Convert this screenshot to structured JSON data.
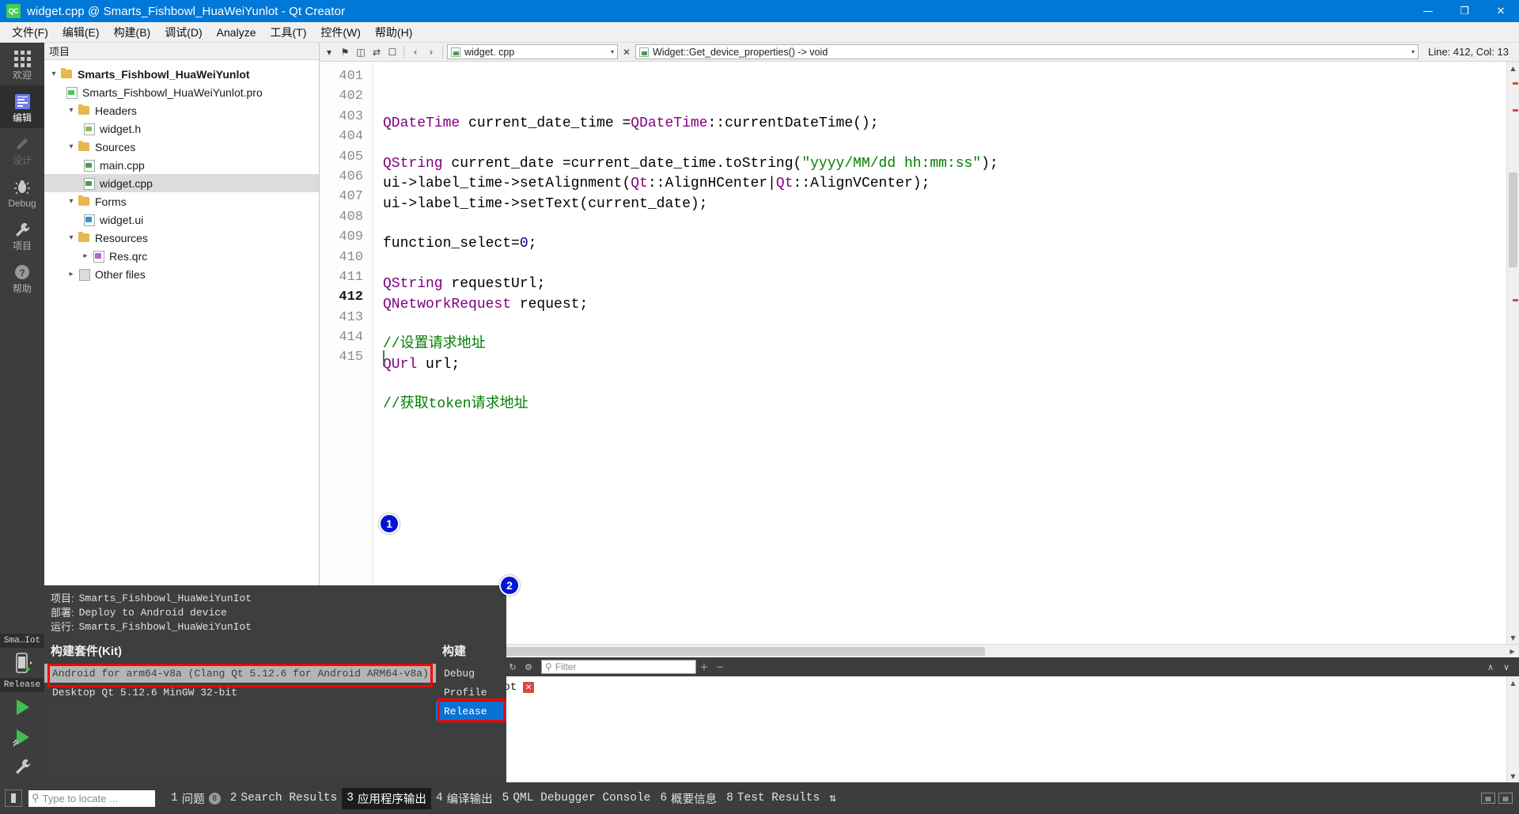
{
  "window": {
    "title": "widget.cpp @ Smarts_Fishbowl_HuaWeiYunlot - Qt Creator",
    "app_icon_text": "QC",
    "minimize": "—",
    "maximize": "❐",
    "close": "✕",
    "titlebar_color": "#0078d7"
  },
  "menubar": {
    "items": [
      {
        "label": "文件(F)"
      },
      {
        "label": "编辑(E)"
      },
      {
        "label": "构建(B)"
      },
      {
        "label": "调试(D)"
      },
      {
        "label": "Analyze"
      },
      {
        "label": "工具(T)"
      },
      {
        "label": "控件(W)"
      },
      {
        "label": "帮助(H)"
      }
    ]
  },
  "modebar": {
    "items": [
      {
        "label": "欢迎",
        "icon": "grid-icon",
        "state": "normal"
      },
      {
        "label": "编辑",
        "icon": "edit-icon",
        "state": "active"
      },
      {
        "label": "设计",
        "icon": "pencil-icon",
        "state": "disabled"
      },
      {
        "label": "Debug",
        "icon": "bug-icon",
        "state": "normal"
      },
      {
        "label": "项目",
        "icon": "wrench-icon",
        "state": "normal"
      },
      {
        "label": "帮助",
        "icon": "help-icon",
        "state": "normal"
      }
    ],
    "kit_summary": "Sma…Iot",
    "run_label": "Release"
  },
  "project_panel": {
    "header": "项目",
    "tree": [
      {
        "label": "Smarts_Fishbowl_HuaWeiYunlot",
        "indent": 0,
        "arrow": "down",
        "icon": "folder",
        "bold": true,
        "selected": false
      },
      {
        "label": "Smarts_Fishbowl_HuaWeiYunlot.pro",
        "indent": 1,
        "arrow": "none",
        "icon": "qtproj",
        "bold": false,
        "selected": false
      },
      {
        "label": "Headers",
        "indent": 1,
        "arrow": "down",
        "icon": "folder",
        "bold": false,
        "selected": false
      },
      {
        "label": "widget.h",
        "indent": 2,
        "arrow": "none",
        "icon": "hfile",
        "bold": false,
        "selected": false
      },
      {
        "label": "Sources",
        "indent": 1,
        "arrow": "down",
        "icon": "folder",
        "bold": false,
        "selected": false
      },
      {
        "label": "main.cpp",
        "indent": 2,
        "arrow": "none",
        "icon": "cfile",
        "bold": false,
        "selected": false
      },
      {
        "label": "widget.cpp",
        "indent": 2,
        "arrow": "none",
        "icon": "cfile",
        "bold": false,
        "selected": true
      },
      {
        "label": "Forms",
        "indent": 1,
        "arrow": "down",
        "icon": "folder",
        "bold": false,
        "selected": false
      },
      {
        "label": "widget.ui",
        "indent": 2,
        "arrow": "none",
        "icon": "ui",
        "bold": false,
        "selected": false
      },
      {
        "label": "Resources",
        "indent": 1,
        "arrow": "down",
        "icon": "folder",
        "bold": false,
        "selected": false
      },
      {
        "label": "Res.qrc",
        "indent": 2,
        "arrow": "right",
        "icon": "qrc",
        "bold": false,
        "selected": false
      },
      {
        "label": "Other files",
        "indent": 1,
        "arrow": "right",
        "icon": "other",
        "bold": false,
        "selected": false
      }
    ]
  },
  "editor_toolbar": {
    "file_combo": "widget. cpp",
    "symbol_combo": "Widget::Get_device_properties() -> void",
    "line_col": "Line: 412, Col: 13",
    "close_x": "✕",
    "split_caret": "▾"
  },
  "editor": {
    "first_line": 401,
    "current_line": 412,
    "caret_line": 415,
    "lines": [
      {
        "n": 401,
        "tokens": [
          {
            "t": "QDateTime",
            "c": "type"
          },
          {
            "t": " current_date_time =",
            "c": "plain"
          },
          {
            "t": "QDateTime",
            "c": "type"
          },
          {
            "t": "::",
            "c": "plain"
          },
          {
            "t": "currentDateTime",
            "c": "fn"
          },
          {
            "t": "();",
            "c": "plain"
          }
        ]
      },
      {
        "n": 402,
        "tokens": []
      },
      {
        "n": 403,
        "tokens": [
          {
            "t": "QString",
            "c": "type"
          },
          {
            "t": " current_date =current_date_time.",
            "c": "plain"
          },
          {
            "t": "toString",
            "c": "fn"
          },
          {
            "t": "(",
            "c": "plain"
          },
          {
            "t": "\"yyyy/MM/dd hh:mm:ss\"",
            "c": "str"
          },
          {
            "t": ");",
            "c": "plain"
          }
        ]
      },
      {
        "n": 404,
        "tokens": [
          {
            "t": "ui->label_time->",
            "c": "plain"
          },
          {
            "t": "setAlignment",
            "c": "fn"
          },
          {
            "t": "(",
            "c": "plain"
          },
          {
            "t": "Qt",
            "c": "type"
          },
          {
            "t": "::",
            "c": "plain"
          },
          {
            "t": "AlignHCenter",
            "c": "fn"
          },
          {
            "t": "|",
            "c": "plain"
          },
          {
            "t": "Qt",
            "c": "type"
          },
          {
            "t": "::",
            "c": "plain"
          },
          {
            "t": "AlignVCenter",
            "c": "fn"
          },
          {
            "t": ");",
            "c": "plain"
          }
        ]
      },
      {
        "n": 405,
        "tokens": [
          {
            "t": "ui->label_time->",
            "c": "plain"
          },
          {
            "t": "setText",
            "c": "fn"
          },
          {
            "t": "(current_date);",
            "c": "plain"
          }
        ]
      },
      {
        "n": 406,
        "tokens": []
      },
      {
        "n": 407,
        "tokens": [
          {
            "t": "function_select=",
            "c": "plain"
          },
          {
            "t": "0",
            "c": "num"
          },
          {
            "t": ";",
            "c": "plain"
          }
        ]
      },
      {
        "n": 408,
        "tokens": []
      },
      {
        "n": 409,
        "tokens": [
          {
            "t": "QString",
            "c": "type"
          },
          {
            "t": " requestUrl;",
            "c": "plain"
          }
        ]
      },
      {
        "n": 410,
        "tokens": [
          {
            "t": "QNetworkRequest",
            "c": "type"
          },
          {
            "t": " request;",
            "c": "plain"
          }
        ]
      },
      {
        "n": 411,
        "tokens": []
      },
      {
        "n": 412,
        "tokens": [
          {
            "t": "//设置请求地址",
            "c": "cmt"
          }
        ]
      },
      {
        "n": 413,
        "tokens": [
          {
            "t": "QUrl",
            "c": "type"
          },
          {
            "t": " url;",
            "c": "plain"
          }
        ]
      },
      {
        "n": 414,
        "tokens": []
      },
      {
        "n": 415,
        "tokens": [
          {
            "t": "//获取token请求地址",
            "c": "cmt"
          }
        ]
      }
    ]
  },
  "output_pane": {
    "title": "应用程序输出",
    "filter_placeholder": "Filter",
    "tab_label": "Smarts_Fishbowl_HuaWeiYunIot",
    "stop_glyph": "✕",
    "buttons": {
      "wrap": "↵",
      "prev": "‹",
      "next": "›",
      "run": "▶",
      "stop": "■",
      "reload": "↻",
      "settings": "⚙",
      "search": "⌕",
      "zoom_in": "＋",
      "zoom_out": "－",
      "maximize": "∧",
      "minimize": "∨"
    }
  },
  "kit_popup": {
    "info": [
      {
        "key": "项目:",
        "value": "Smarts_Fishbowl_HuaWeiYunIot"
      },
      {
        "key": "部署:",
        "value": "Deploy to Android device"
      },
      {
        "key": "运行:",
        "value": "Smarts_Fishbowl_HuaWeiYunIot"
      }
    ],
    "kit_header": "构建套件(Kit)",
    "kits": [
      {
        "label": "Android for arm64-v8a (Clang Qt 5.12.6 for Android ARM64-v8a)",
        "selected": true
      },
      {
        "label": "Desktop Qt 5.12.6 MinGW 32-bit",
        "selected": false
      }
    ],
    "build_header": "构建",
    "builds": [
      {
        "label": "Debug",
        "selected": false
      },
      {
        "label": "Profile",
        "selected": false
      },
      {
        "label": "Release",
        "selected": true
      }
    ],
    "badges": [
      {
        "text": "1"
      },
      {
        "text": "2"
      }
    ],
    "highlight_color": "#ff0000",
    "badge_color": "#0014d4"
  },
  "statusbar": {
    "locator_placeholder": "Type to locate ...",
    "tabs": [
      {
        "num": "1",
        "label": "问题",
        "count": "8",
        "active": false
      },
      {
        "num": "2",
        "label": "Search Results",
        "count": "",
        "active": false
      },
      {
        "num": "3",
        "label": "应用程序输出",
        "count": "",
        "active": true
      },
      {
        "num": "4",
        "label": "编译输出",
        "count": "",
        "active": false
      },
      {
        "num": "5",
        "label": "QML Debugger Console",
        "count": "",
        "active": false
      },
      {
        "num": "6",
        "label": "概要信息",
        "count": "",
        "active": false
      },
      {
        "num": "8",
        "label": "Test Results",
        "count": "",
        "active": false
      }
    ],
    "updown_glyph": "⇅",
    "right_buttons": [
      "⬒",
      "⬓"
    ]
  }
}
